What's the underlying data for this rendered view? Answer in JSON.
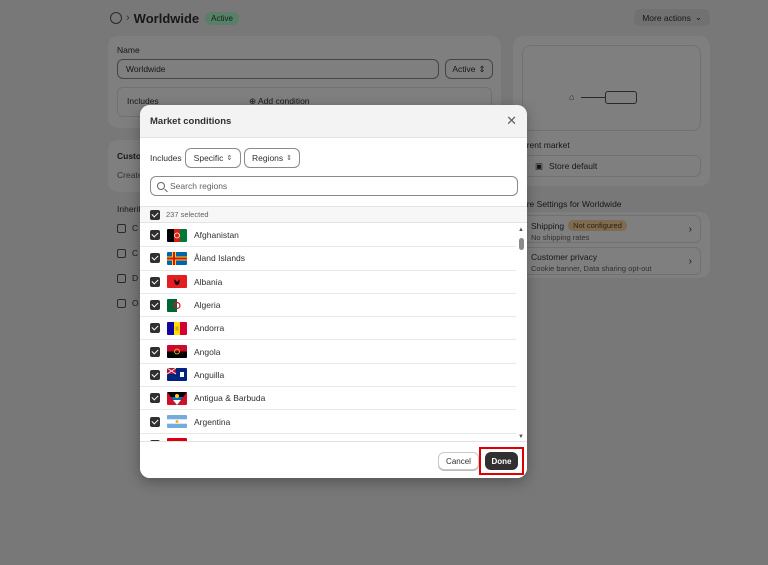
{
  "page": {
    "title": "Worldwide",
    "status_badge": "Active",
    "more_actions": "More actions",
    "name_label": "Name",
    "name_value": "Worldwide",
    "status_select": "Active",
    "includes_label": "Includes",
    "add_condition": "Add condition",
    "customize_title": "Custo",
    "customize_desc": "Create",
    "inherit_title": "Inherit",
    "inherit_items": [
      "C",
      "C",
      "D",
      "O"
    ],
    "parent_market_label": "arent market",
    "store_default": "Store default",
    "more_settings_title": "ore Settings for Worldwide",
    "shipping_title": "Shipping",
    "shipping_badge": "Not configured",
    "shipping_desc": "No shipping rates",
    "privacy_title": "Customer privacy",
    "privacy_desc": "Cookie banner, Data sharing opt-out"
  },
  "modal": {
    "title": "Market conditions",
    "includes_label": "Includes",
    "specific_select": "Specific",
    "regions_select": "Regions",
    "search_placeholder": "Search regions",
    "selected_count": "237 selected",
    "countries": [
      {
        "name": "Afghanistan"
      },
      {
        "name": "Åland Islands"
      },
      {
        "name": "Albania"
      },
      {
        "name": "Algeria"
      },
      {
        "name": "Andorra"
      },
      {
        "name": "Angola"
      },
      {
        "name": "Anguilla"
      },
      {
        "name": "Antigua & Barbuda"
      },
      {
        "name": "Argentina"
      },
      {
        "name": "A"
      }
    ],
    "cancel_label": "Cancel",
    "done_label": "Done"
  },
  "icons": {
    "globe": "globe-icon",
    "close": "close-icon",
    "search": "search-icon",
    "store": "store-icon",
    "chevron_right": "chevron-right-icon"
  }
}
